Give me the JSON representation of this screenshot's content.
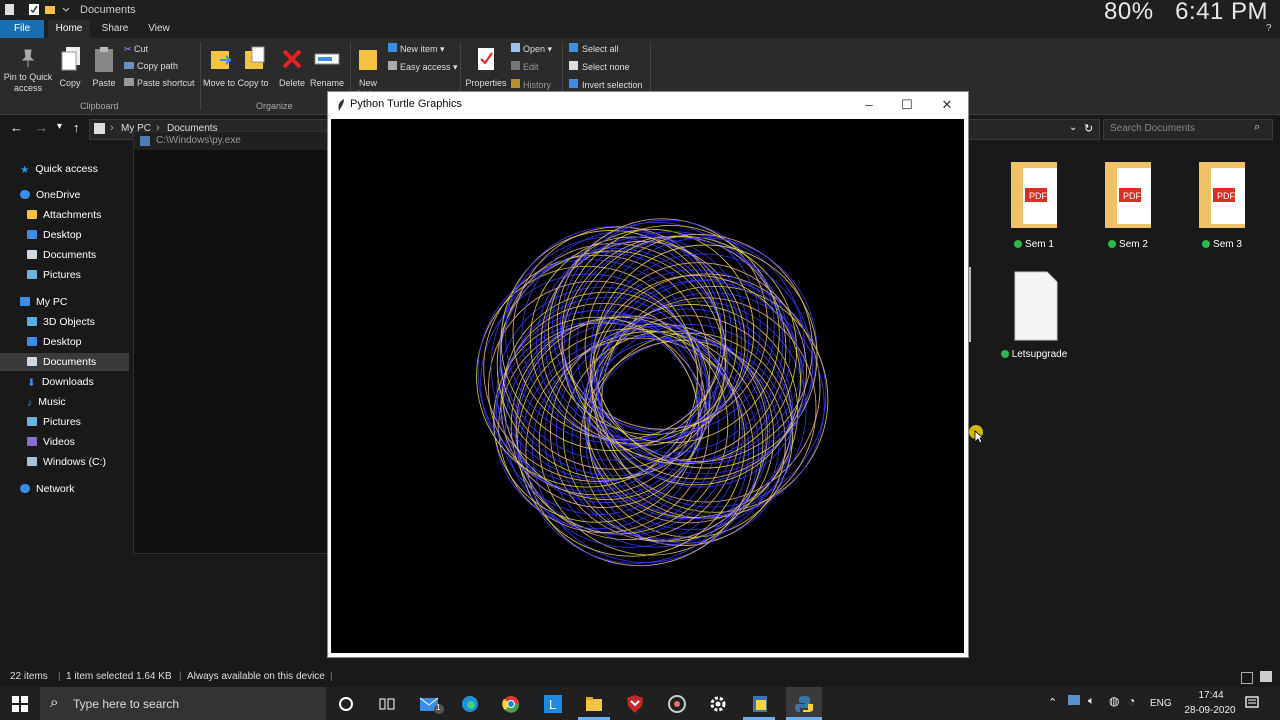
{
  "window": {
    "title": "Documents"
  },
  "overlay": {
    "battery": "80%",
    "clock": "6:41 PM"
  },
  "ribbon": {
    "tabs": [
      "File",
      "Home",
      "Share",
      "View"
    ],
    "clipboard": {
      "pin": "Pin to Quick access",
      "copy": "Copy",
      "paste": "Paste",
      "cut": "Cut",
      "copy_path": "Copy path",
      "paste_shortcut": "Paste shortcut",
      "group": "Clipboard"
    },
    "organize": {
      "move_to": "Move to",
      "copy_to": "Copy to",
      "delete": "Delete",
      "rename": "Rename",
      "group": "Organize"
    },
    "new": {
      "new_folder": "New folder",
      "new_item": "New item",
      "easy_access": "Easy access"
    },
    "open": {
      "properties": "Properties",
      "open": "Open",
      "edit": "Edit",
      "history": "History"
    },
    "select": {
      "select_all": "Select all",
      "select_none": "Select none",
      "invert": "Invert selection"
    }
  },
  "address": {
    "crumb1": "My PC",
    "crumb2": "Documents",
    "search_placeholder": "Search Documents",
    "dropdown_path": "C:\\Windows\\py.exe"
  },
  "nav": {
    "quick_access": "Quick access",
    "onedrive": "OneDrive",
    "onedrive_items": [
      "Attachments",
      "Desktop",
      "Documents",
      "Pictures"
    ],
    "mypc": "My PC",
    "mypc_items": [
      "3D Objects",
      "Desktop",
      "Documents",
      "Downloads",
      "Music",
      "Pictures",
      "Videos",
      "Windows (C:)"
    ],
    "network": "Network"
  },
  "files": [
    {
      "name": "Sem 1",
      "type": "pdf-folder"
    },
    {
      "name": "Sem 2",
      "type": "pdf-folder"
    },
    {
      "name": "Sem 3",
      "type": "pdf-folder"
    },
    {
      "name": "Letsupgrade",
      "type": "document"
    }
  ],
  "turtle": {
    "title": "Python Turtle Graphics"
  },
  "status": {
    "items": "22 items",
    "selected": "1 item selected  1.64 KB",
    "availability": "Always available on this device"
  },
  "taskbar": {
    "search_placeholder": "Type here to search",
    "lang": "ENG",
    "time": "17:44",
    "date": "28-09-2020",
    "mail_badge": "1"
  },
  "colors": {
    "accent": "#1a6fb3",
    "spiro_blue": "#3a3aff",
    "spiro_yellow": "#e8d84a",
    "spiro_peach": "#f0b88a"
  }
}
